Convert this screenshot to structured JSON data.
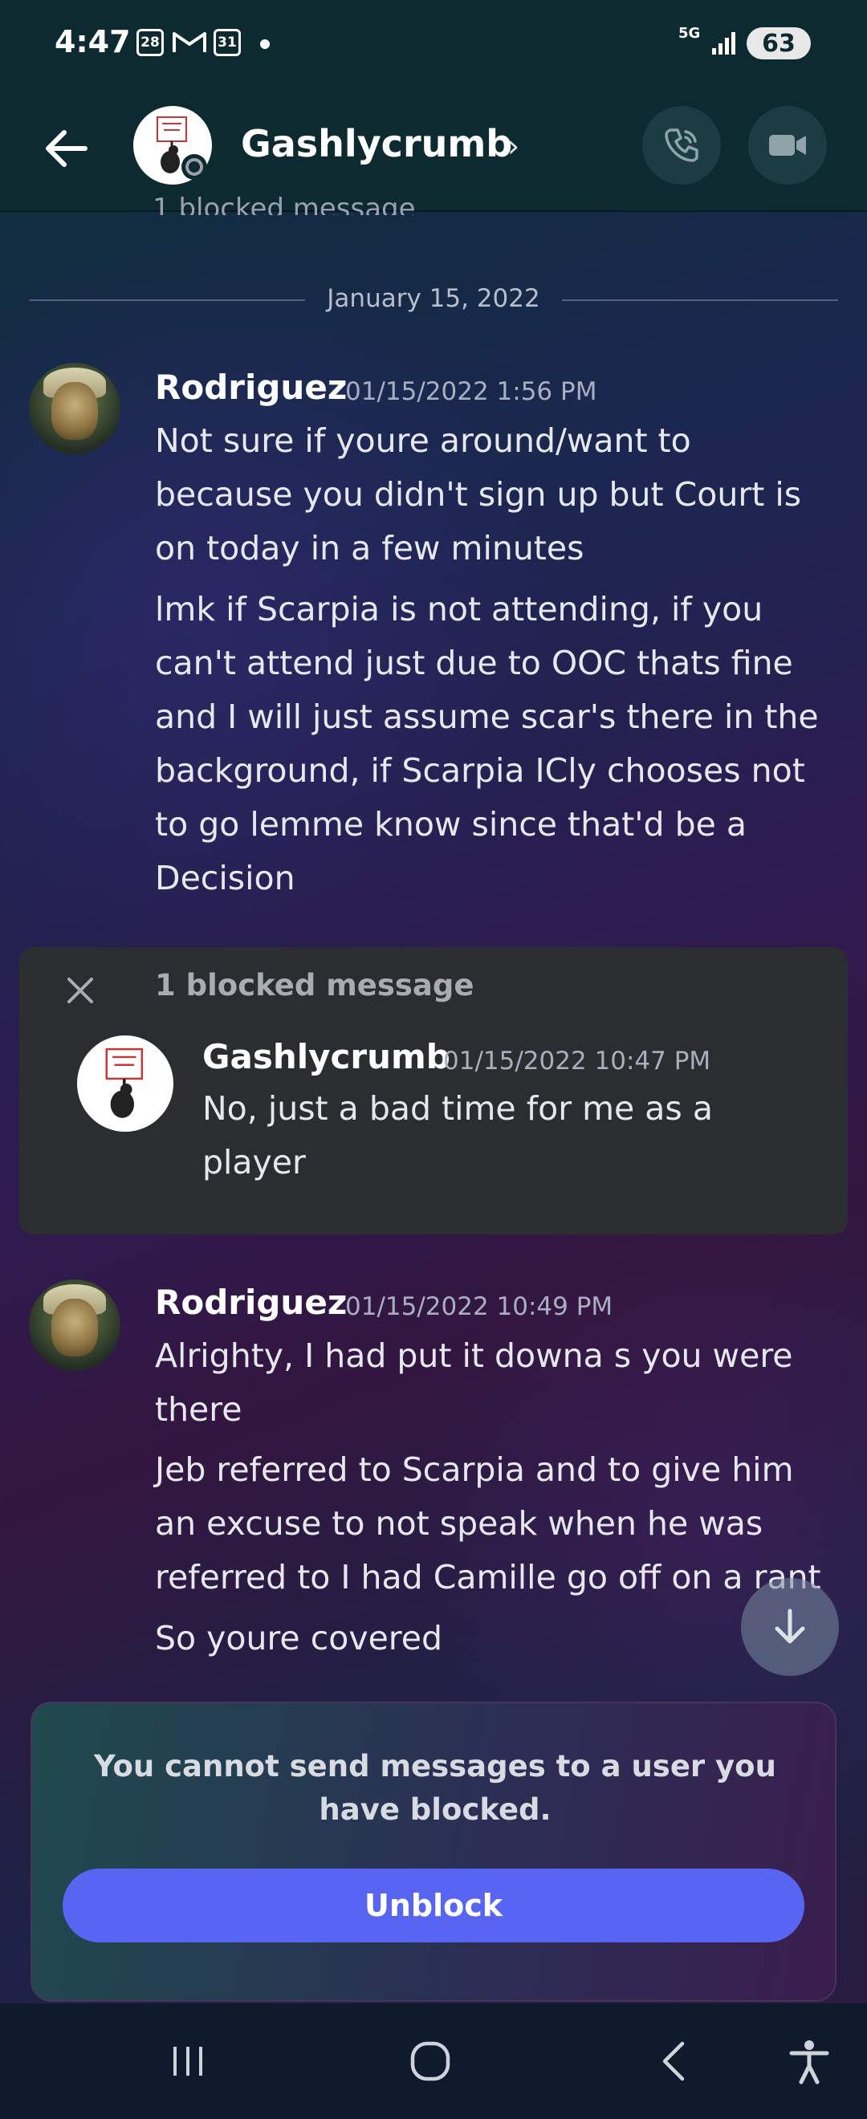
{
  "status_bar": {
    "time": "4:47",
    "calendar_day": "28",
    "calendar2_day": "31",
    "network": "5G",
    "battery": "63"
  },
  "header": {
    "back_icon": "arrow-left-icon",
    "title": "Gashlycrumb",
    "call_icon": "phone-icon",
    "video_icon": "video-camera-icon"
  },
  "chat": {
    "ghost_text": "1 blocked message",
    "date_divider": "January 15, 2022",
    "messages": [
      {
        "author": "Rodriguez",
        "timestamp": "01/15/2022 1:56 PM",
        "lines": [
          "Not sure if youre around/want to because you didn't sign up but Court is on today in a few minutes",
          "lmk if Scarpia is not attending, if you can't attend just due to OOC thats fine and I will just assume scar's there in the background, if Scarpia ICly chooses not to go lemme know since that'd be a Decision"
        ]
      },
      {
        "author": "Rodriguez",
        "timestamp": "01/15/2022 10:49 PM",
        "lines": [
          "Alrighty, I had put it downa s you were there",
          "Jeb referred to Scarpia and to give him an excuse to not speak when he was referred to I had Camille go off on a rant",
          "So youre covered"
        ]
      }
    ],
    "blocked_group": {
      "label": "1 blocked message",
      "author": "Gashlycrumb",
      "timestamp": "01/15/2022 10:47 PM",
      "text": "No, just a bad time for me as a player"
    }
  },
  "notice": {
    "text": "You cannot send messages to a user you have blocked.",
    "button": "Unblock"
  },
  "colors": {
    "accent": "#5865f2",
    "header_bg": "#0c2a30",
    "blocked_bg": "#2b2d31"
  }
}
